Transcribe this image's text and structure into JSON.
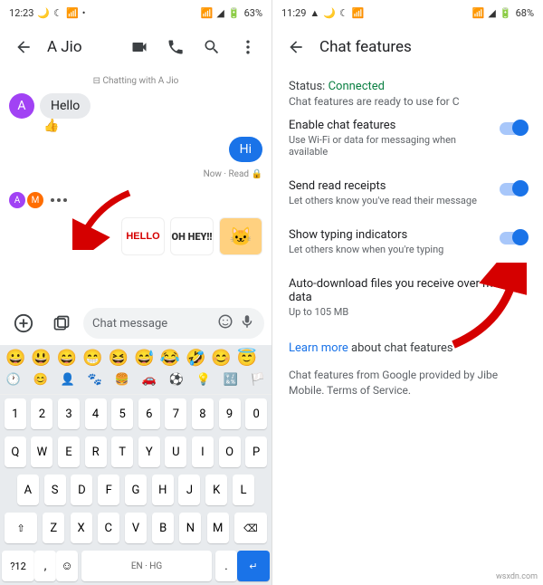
{
  "left": {
    "status": {
      "time": "12:23",
      "battery": "63%"
    },
    "header": {
      "title": "A Jio"
    },
    "chatting_with": "⊟ Chatting with A Jio",
    "messages": {
      "incoming": "Hello",
      "reaction": "👍",
      "outgoing": "Hi",
      "outgoing_meta": "Now · Read 🔒"
    },
    "stickers": {
      "hello": "HELLO",
      "hey": "OH HEY‼",
      "cat": "🐱"
    },
    "compose": {
      "placeholder": "Chat message"
    },
    "keyboard": {
      "emoji_row": [
        "😀",
        "😃",
        "😄",
        "😁",
        "😆",
        "😅",
        "😂",
        "🤣",
        "😊",
        "😇"
      ],
      "num_row": [
        "1",
        "2",
        "3",
        "4",
        "5",
        "6",
        "7",
        "8",
        "9",
        "0"
      ],
      "row1": [
        "Q",
        "W",
        "E",
        "R",
        "T",
        "Y",
        "U",
        "I",
        "O",
        "P"
      ],
      "row2": [
        "A",
        "S",
        "D",
        "F",
        "G",
        "H",
        "J",
        "K",
        "L"
      ],
      "row3_shift": "⇧",
      "row3": [
        "Z",
        "X",
        "C",
        "V",
        "B",
        "N",
        "M"
      ],
      "row3_back": "⌫",
      "bottom": {
        "sym": "?12",
        "lang": "EN · HG",
        "enter": "↵"
      }
    }
  },
  "right": {
    "status": {
      "time": "11:29",
      "battery": "68%"
    },
    "header": {
      "title": "Chat features"
    },
    "status_label": "Status:",
    "status_value": "Connected",
    "status_sub": "Chat features are ready to use for C",
    "settings": [
      {
        "title": "Enable chat features",
        "sub": "Use Wi-Fi or data for messaging when available"
      },
      {
        "title": "Send read receipts",
        "sub": "Let others know you've read their message"
      },
      {
        "title": "Show typing indicators",
        "sub": "Let others know when you're typing"
      },
      {
        "title": "Auto-download files you receive over mobile data",
        "sub": "Up to 105 MB"
      }
    ],
    "learn_more": "Learn more",
    "learn_more_tail": " about chat features",
    "footer": "Chat features from Google provided by Jibe Mobile. Terms of Service."
  },
  "watermark": "wsxdn.com"
}
